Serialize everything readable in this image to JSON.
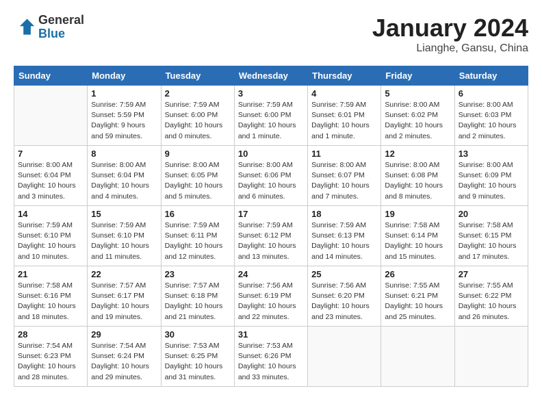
{
  "header": {
    "logo_general": "General",
    "logo_blue": "Blue",
    "title": "January 2024",
    "location": "Lianghe, Gansu, China"
  },
  "days_of_week": [
    "Sunday",
    "Monday",
    "Tuesday",
    "Wednesday",
    "Thursday",
    "Friday",
    "Saturday"
  ],
  "weeks": [
    [
      {
        "day": "",
        "sunrise": "",
        "sunset": "",
        "daylight": ""
      },
      {
        "day": "1",
        "sunrise": "Sunrise: 7:59 AM",
        "sunset": "Sunset: 5:59 PM",
        "daylight": "Daylight: 9 hours and 59 minutes."
      },
      {
        "day": "2",
        "sunrise": "Sunrise: 7:59 AM",
        "sunset": "Sunset: 6:00 PM",
        "daylight": "Daylight: 10 hours and 0 minutes."
      },
      {
        "day": "3",
        "sunrise": "Sunrise: 7:59 AM",
        "sunset": "Sunset: 6:00 PM",
        "daylight": "Daylight: 10 hours and 1 minute."
      },
      {
        "day": "4",
        "sunrise": "Sunrise: 7:59 AM",
        "sunset": "Sunset: 6:01 PM",
        "daylight": "Daylight: 10 hours and 1 minute."
      },
      {
        "day": "5",
        "sunrise": "Sunrise: 8:00 AM",
        "sunset": "Sunset: 6:02 PM",
        "daylight": "Daylight: 10 hours and 2 minutes."
      },
      {
        "day": "6",
        "sunrise": "Sunrise: 8:00 AM",
        "sunset": "Sunset: 6:03 PM",
        "daylight": "Daylight: 10 hours and 2 minutes."
      }
    ],
    [
      {
        "day": "7",
        "sunrise": "Sunrise: 8:00 AM",
        "sunset": "Sunset: 6:04 PM",
        "daylight": "Daylight: 10 hours and 3 minutes."
      },
      {
        "day": "8",
        "sunrise": "Sunrise: 8:00 AM",
        "sunset": "Sunset: 6:04 PM",
        "daylight": "Daylight: 10 hours and 4 minutes."
      },
      {
        "day": "9",
        "sunrise": "Sunrise: 8:00 AM",
        "sunset": "Sunset: 6:05 PM",
        "daylight": "Daylight: 10 hours and 5 minutes."
      },
      {
        "day": "10",
        "sunrise": "Sunrise: 8:00 AM",
        "sunset": "Sunset: 6:06 PM",
        "daylight": "Daylight: 10 hours and 6 minutes."
      },
      {
        "day": "11",
        "sunrise": "Sunrise: 8:00 AM",
        "sunset": "Sunset: 6:07 PM",
        "daylight": "Daylight: 10 hours and 7 minutes."
      },
      {
        "day": "12",
        "sunrise": "Sunrise: 8:00 AM",
        "sunset": "Sunset: 6:08 PM",
        "daylight": "Daylight: 10 hours and 8 minutes."
      },
      {
        "day": "13",
        "sunrise": "Sunrise: 8:00 AM",
        "sunset": "Sunset: 6:09 PM",
        "daylight": "Daylight: 10 hours and 9 minutes."
      }
    ],
    [
      {
        "day": "14",
        "sunrise": "Sunrise: 7:59 AM",
        "sunset": "Sunset: 6:10 PM",
        "daylight": "Daylight: 10 hours and 10 minutes."
      },
      {
        "day": "15",
        "sunrise": "Sunrise: 7:59 AM",
        "sunset": "Sunset: 6:10 PM",
        "daylight": "Daylight: 10 hours and 11 minutes."
      },
      {
        "day": "16",
        "sunrise": "Sunrise: 7:59 AM",
        "sunset": "Sunset: 6:11 PM",
        "daylight": "Daylight: 10 hours and 12 minutes."
      },
      {
        "day": "17",
        "sunrise": "Sunrise: 7:59 AM",
        "sunset": "Sunset: 6:12 PM",
        "daylight": "Daylight: 10 hours and 13 minutes."
      },
      {
        "day": "18",
        "sunrise": "Sunrise: 7:59 AM",
        "sunset": "Sunset: 6:13 PM",
        "daylight": "Daylight: 10 hours and 14 minutes."
      },
      {
        "day": "19",
        "sunrise": "Sunrise: 7:58 AM",
        "sunset": "Sunset: 6:14 PM",
        "daylight": "Daylight: 10 hours and 15 minutes."
      },
      {
        "day": "20",
        "sunrise": "Sunrise: 7:58 AM",
        "sunset": "Sunset: 6:15 PM",
        "daylight": "Daylight: 10 hours and 17 minutes."
      }
    ],
    [
      {
        "day": "21",
        "sunrise": "Sunrise: 7:58 AM",
        "sunset": "Sunset: 6:16 PM",
        "daylight": "Daylight: 10 hours and 18 minutes."
      },
      {
        "day": "22",
        "sunrise": "Sunrise: 7:57 AM",
        "sunset": "Sunset: 6:17 PM",
        "daylight": "Daylight: 10 hours and 19 minutes."
      },
      {
        "day": "23",
        "sunrise": "Sunrise: 7:57 AM",
        "sunset": "Sunset: 6:18 PM",
        "daylight": "Daylight: 10 hours and 21 minutes."
      },
      {
        "day": "24",
        "sunrise": "Sunrise: 7:56 AM",
        "sunset": "Sunset: 6:19 PM",
        "daylight": "Daylight: 10 hours and 22 minutes."
      },
      {
        "day": "25",
        "sunrise": "Sunrise: 7:56 AM",
        "sunset": "Sunset: 6:20 PM",
        "daylight": "Daylight: 10 hours and 23 minutes."
      },
      {
        "day": "26",
        "sunrise": "Sunrise: 7:55 AM",
        "sunset": "Sunset: 6:21 PM",
        "daylight": "Daylight: 10 hours and 25 minutes."
      },
      {
        "day": "27",
        "sunrise": "Sunrise: 7:55 AM",
        "sunset": "Sunset: 6:22 PM",
        "daylight": "Daylight: 10 hours and 26 minutes."
      }
    ],
    [
      {
        "day": "28",
        "sunrise": "Sunrise: 7:54 AM",
        "sunset": "Sunset: 6:23 PM",
        "daylight": "Daylight: 10 hours and 28 minutes."
      },
      {
        "day": "29",
        "sunrise": "Sunrise: 7:54 AM",
        "sunset": "Sunset: 6:24 PM",
        "daylight": "Daylight: 10 hours and 29 minutes."
      },
      {
        "day": "30",
        "sunrise": "Sunrise: 7:53 AM",
        "sunset": "Sunset: 6:25 PM",
        "daylight": "Daylight: 10 hours and 31 minutes."
      },
      {
        "day": "31",
        "sunrise": "Sunrise: 7:53 AM",
        "sunset": "Sunset: 6:26 PM",
        "daylight": "Daylight: 10 hours and 33 minutes."
      },
      {
        "day": "",
        "sunrise": "",
        "sunset": "",
        "daylight": ""
      },
      {
        "day": "",
        "sunrise": "",
        "sunset": "",
        "daylight": ""
      },
      {
        "day": "",
        "sunrise": "",
        "sunset": "",
        "daylight": ""
      }
    ]
  ]
}
